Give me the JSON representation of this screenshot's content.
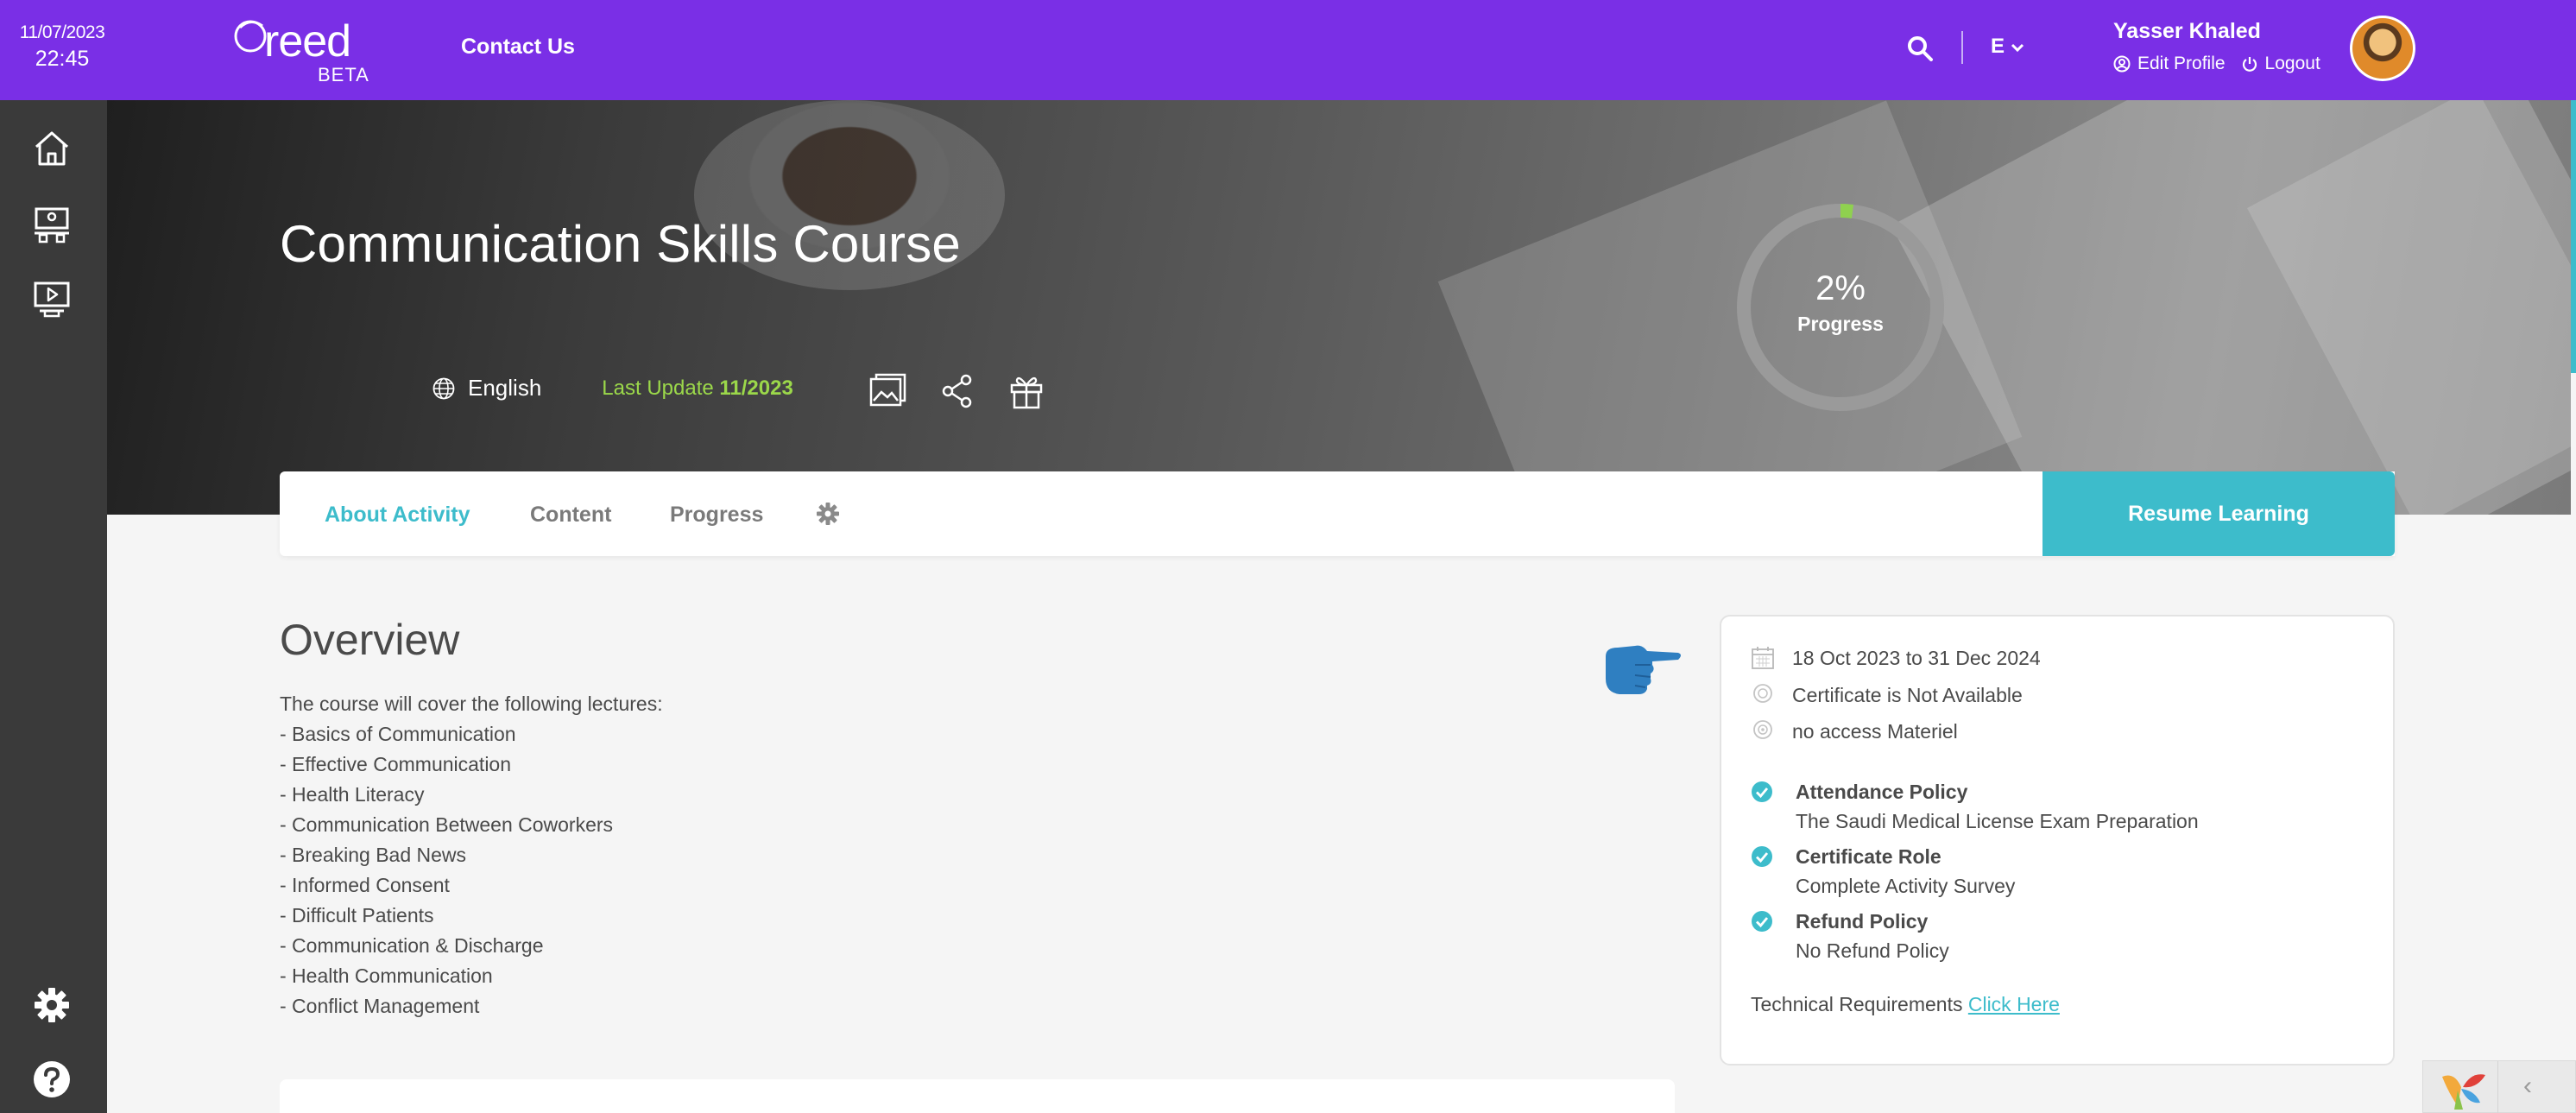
{
  "header": {
    "date": "11/07/2023",
    "time": "22:45",
    "logo_word": "reed",
    "logo_badge": "BETA",
    "contact_label": "Contact Us",
    "language": "E",
    "user_name": "Yasser Khaled",
    "edit_profile_label": "Edit Profile",
    "logout_label": "Logout"
  },
  "sidebar": {
    "items": [
      "home-icon",
      "classroom-icon",
      "video-course-icon"
    ],
    "bottom_items": [
      "settings-icon",
      "help-icon"
    ]
  },
  "course": {
    "title": "Communication Skills Course",
    "language": "English",
    "last_update_label": "Last Update",
    "last_update_value": "11/2023",
    "progress_percent": 2,
    "progress_text": "2%",
    "progress_label": "Progress"
  },
  "tabs": {
    "about": "About Activity",
    "content": "Content",
    "progress": "Progress"
  },
  "resume_label": "Resume Learning",
  "overview": {
    "title": "Overview",
    "intro": "The course will cover the following lectures:",
    "lectures": [
      "- Basics of Communication",
      "- Effective Communication",
      "- Health Literacy",
      "- Communication Between Coworkers",
      "- Breaking Bad News",
      "- Informed Consent",
      "- Difficult Patients",
      "- Communication & Discharge",
      "- Health Communication",
      "- Conflict Management"
    ]
  },
  "info": {
    "dates": "18 Oct 2023 to 31 Dec 2024",
    "certificate": "Certificate is Not Available",
    "access": "no access Materiel",
    "policies": [
      {
        "title": "Attendance Policy",
        "value": "The Saudi Medical License Exam Preparation"
      },
      {
        "title": "Certificate Role",
        "value": "Complete Activity Survey"
      },
      {
        "title": "Refund Policy",
        "value": "No Refund Policy"
      }
    ],
    "tech_label": "Technical Requirements",
    "tech_link": "Click Here"
  },
  "colors": {
    "brand": "#7a2fe6",
    "accent": "#3dbccb",
    "update_green": "#9bd84a",
    "sidebar": "#3a3a3a"
  }
}
